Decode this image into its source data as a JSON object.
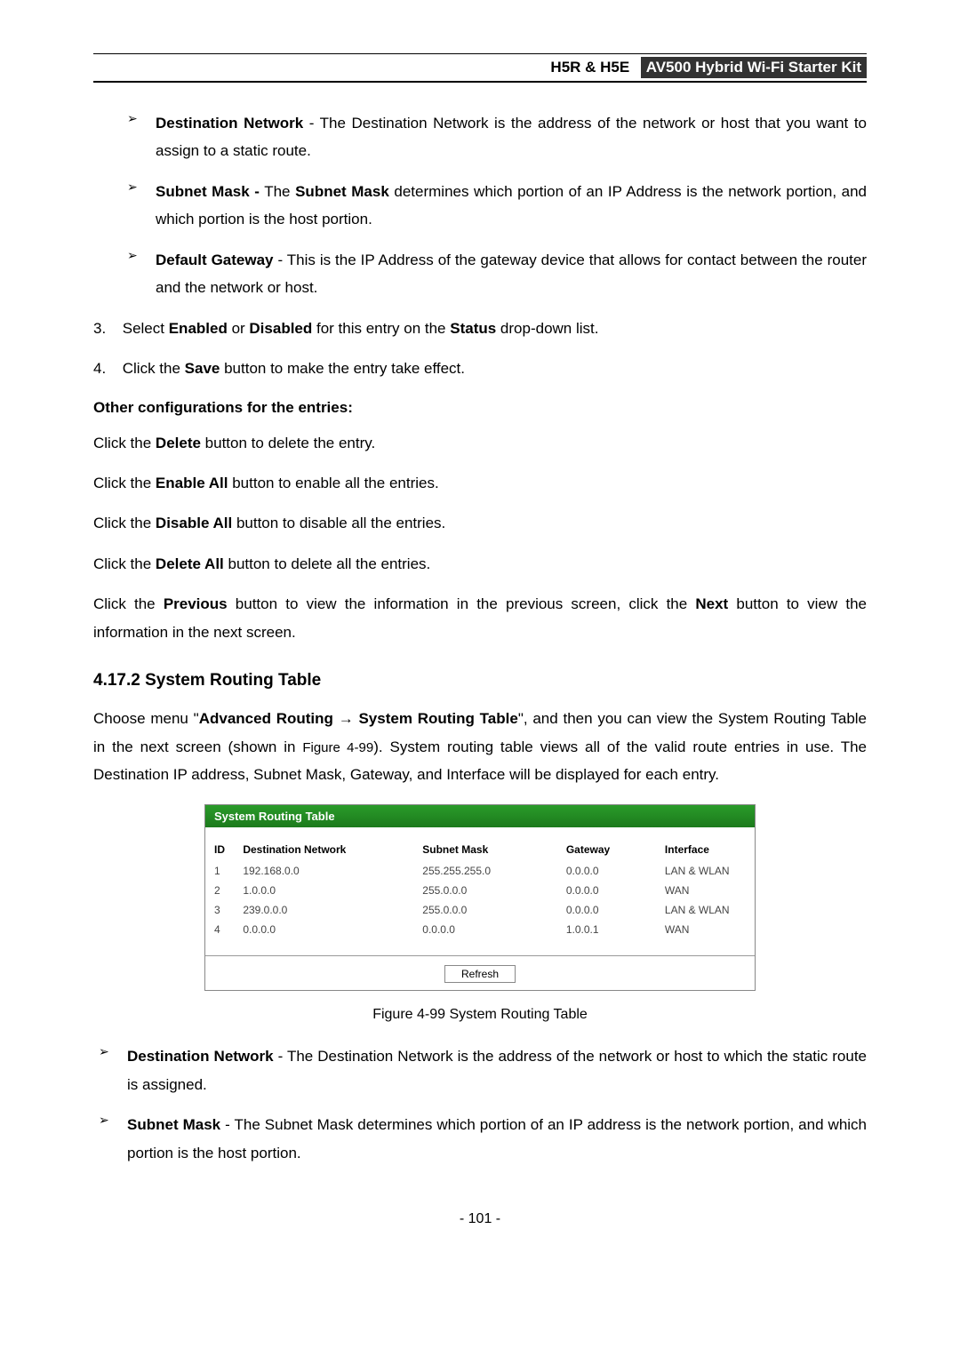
{
  "header": {
    "product": "H5R & H5E",
    "tagline": "AV500 Hybrid Wi-Fi Starter Kit"
  },
  "top_list": [
    {
      "label": "Destination Network",
      "text": " - The Destination Network is the address of the network or host that you want to assign to a static route."
    },
    {
      "label": "Subnet Mask -",
      "pre": " The ",
      "label2": "Subnet Mask",
      "text": " determines which portion of an IP Address is the network portion, and which portion is the host portion."
    },
    {
      "label": "Default Gateway",
      "text": " - This is the IP Address of the gateway device that allows for contact between the router and the network or host."
    }
  ],
  "numbered": [
    {
      "n": "3.",
      "pre": "Select ",
      "b1": "Enabled",
      "mid1": " or ",
      "b2": "Disabled",
      "mid2": " for this entry on the ",
      "b3": "Status",
      "post": " drop-down list."
    },
    {
      "n": "4.",
      "pre": "Click the ",
      "b1": "Save",
      "post": " button to make the entry take effect."
    }
  ],
  "other_header": "Other configurations for the entries:",
  "other_lines": [
    {
      "pre": "Click the ",
      "b": "Delete",
      "post": " button to delete the entry."
    },
    {
      "pre": "Click the ",
      "b": "Enable All",
      "post": " button to enable all the entries."
    },
    {
      "pre": "Click the ",
      "b": "Disable All",
      "post": " button to disable all the entries."
    },
    {
      "pre": "Click the ",
      "b": "Delete All",
      "post": " button to delete all the entries."
    }
  ],
  "prev_next": {
    "pre": "Click the ",
    "b1": "Previous",
    "mid": " button to view the information in the previous screen, click the ",
    "b2": "Next",
    "post": " button to view the information in the next screen."
  },
  "section_title": "4.17.2  System Routing Table",
  "section_para": {
    "pre": "Choose menu \"",
    "b1": "Advanced Routing",
    "arrow": " → ",
    "b2": "System Routing Table",
    "mid": "\", and then you can view the System Routing Table in the next screen (shown in ",
    "figref": "Figure 4-99",
    "post": "). System routing table views all of the valid route entries in use. The Destination IP address, Subnet Mask, Gateway, and Interface will be displayed for each entry."
  },
  "chart_data": {
    "type": "table",
    "title": "System Routing Table",
    "columns": [
      "ID",
      "Destination Network",
      "Subnet Mask",
      "Gateway",
      "Interface"
    ],
    "rows": [
      [
        "1",
        "192.168.0.0",
        "255.255.255.0",
        "0.0.0.0",
        "LAN & WLAN"
      ],
      [
        "2",
        "1.0.0.0",
        "255.0.0.0",
        "0.0.0.0",
        "WAN"
      ],
      [
        "3",
        "239.0.0.0",
        "255.0.0.0",
        "0.0.0.0",
        "LAN & WLAN"
      ],
      [
        "4",
        "0.0.0.0",
        "0.0.0.0",
        "1.0.0.1",
        "WAN"
      ]
    ],
    "button": "Refresh"
  },
  "fig_caption": "Figure 4-99 System Routing Table",
  "bottom_list": [
    {
      "label": "Destination Network",
      "text": " - The Destination Network is the address of the network or host to which the static route is assigned."
    },
    {
      "label": "Subnet Mask",
      "text": " - The Subnet Mask determines which portion of an IP address is the network portion, and which portion is the host portion."
    }
  ],
  "page_num": "- 101 -"
}
